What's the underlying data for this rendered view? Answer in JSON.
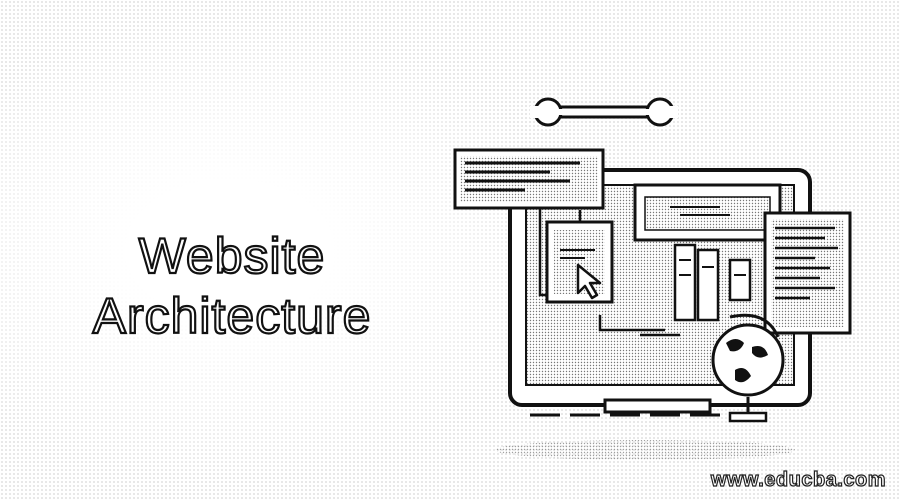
{
  "title": {
    "line1": "Website",
    "line2": "Architecture"
  },
  "watermark": "www.educba.com",
  "illustration": {
    "icons": [
      "wrench-icon",
      "cursor-icon",
      "globe-icon",
      "code-window-icon",
      "monitor-icon"
    ]
  }
}
